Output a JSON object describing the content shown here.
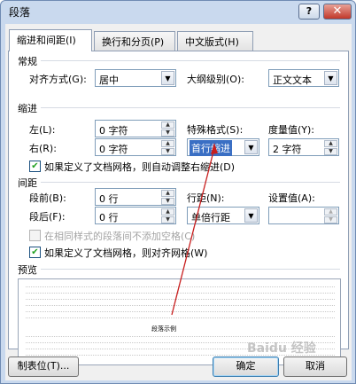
{
  "window": {
    "title": "段落",
    "help": "?",
    "close": "✕"
  },
  "tabs": [
    {
      "label": "缩进和间距(I)"
    },
    {
      "label": "换行和分页(P)"
    },
    {
      "label": "中文版式(H)"
    }
  ],
  "general": {
    "section": "常规",
    "alignment_label": "对齐方式(G):",
    "alignment_value": "居中",
    "outline_label": "大纲级别(O):",
    "outline_value": "正文文本"
  },
  "indent": {
    "section": "缩进",
    "left_label": "左(L):",
    "left_value": "0 字符",
    "right_label": "右(R):",
    "right_value": "0 字符",
    "special_label": "特殊格式(S):",
    "special_value": "首行缩进",
    "measure_label": "度量值(Y):",
    "measure_value": "2 字符",
    "auto_adjust_label": "如果定义了文档网格，则自动调整右缩进(D)",
    "auto_adjust_checked": true
  },
  "spacing": {
    "section": "间距",
    "before_label": "段前(B):",
    "before_value": "0 行",
    "after_label": "段后(F):",
    "after_value": "0 行",
    "line_label": "行距(N):",
    "line_value": "单倍行距",
    "set_label": "设置值(A):",
    "set_value": "",
    "no_space_label": "在相同样式的段落间不添加空格(C)",
    "no_space_checked": false,
    "snap_grid_label": "如果定义了文档网格，则对齐网格(W)",
    "snap_grid_checked": true
  },
  "preview": {
    "section": "预览",
    "sample": "段落示例"
  },
  "buttons": {
    "tabs": "制表位(T)...",
    "ok": "确定",
    "cancel": "取消"
  },
  "icons": {
    "up": "▲",
    "down": "▼",
    "dropdown": "▼",
    "check": "✔"
  },
  "watermark": "Baidu 经验"
}
